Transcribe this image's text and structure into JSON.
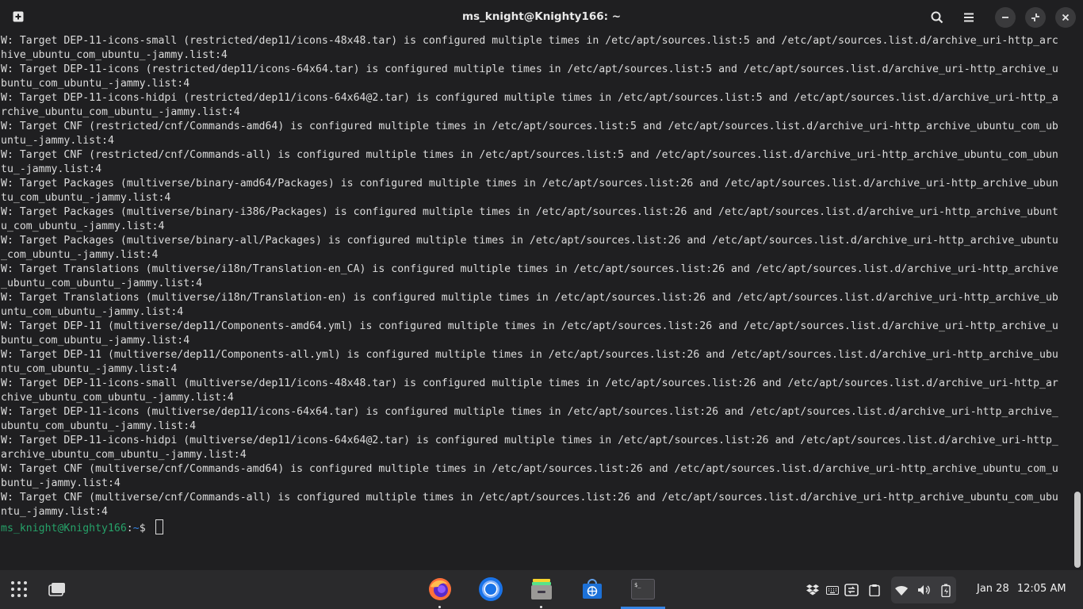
{
  "window": {
    "title": "ms_knight@Knighty166: ~"
  },
  "terminal": {
    "lines": [
      "W: Target DEP-11-icons-small (restricted/dep11/icons-48x48.tar) is configured multiple times in /etc/apt/sources.list:5 and /etc/apt/sources.list.d/archive_uri-http_arc",
      "hive_ubuntu_com_ubuntu_-jammy.list:4",
      "W: Target DEP-11-icons (restricted/dep11/icons-64x64.tar) is configured multiple times in /etc/apt/sources.list:5 and /etc/apt/sources.list.d/archive_uri-http_archive_u",
      "buntu_com_ubuntu_-jammy.list:4",
      "W: Target DEP-11-icons-hidpi (restricted/dep11/icons-64x64@2.tar) is configured multiple times in /etc/apt/sources.list:5 and /etc/apt/sources.list.d/archive_uri-http_a",
      "rchive_ubuntu_com_ubuntu_-jammy.list:4",
      "W: Target CNF (restricted/cnf/Commands-amd64) is configured multiple times in /etc/apt/sources.list:5 and /etc/apt/sources.list.d/archive_uri-http_archive_ubuntu_com_ub",
      "untu_-jammy.list:4",
      "W: Target CNF (restricted/cnf/Commands-all) is configured multiple times in /etc/apt/sources.list:5 and /etc/apt/sources.list.d/archive_uri-http_archive_ubuntu_com_ubun",
      "tu_-jammy.list:4",
      "W: Target Packages (multiverse/binary-amd64/Packages) is configured multiple times in /etc/apt/sources.list:26 and /etc/apt/sources.list.d/archive_uri-http_archive_ubun",
      "tu_com_ubuntu_-jammy.list:4",
      "W: Target Packages (multiverse/binary-i386/Packages) is configured multiple times in /etc/apt/sources.list:26 and /etc/apt/sources.list.d/archive_uri-http_archive_ubunt",
      "u_com_ubuntu_-jammy.list:4",
      "W: Target Packages (multiverse/binary-all/Packages) is configured multiple times in /etc/apt/sources.list:26 and /etc/apt/sources.list.d/archive_uri-http_archive_ubuntu",
      "_com_ubuntu_-jammy.list:4",
      "W: Target Translations (multiverse/i18n/Translation-en_CA) is configured multiple times in /etc/apt/sources.list:26 and /etc/apt/sources.list.d/archive_uri-http_archive",
      "_ubuntu_com_ubuntu_-jammy.list:4",
      "W: Target Translations (multiverse/i18n/Translation-en) is configured multiple times in /etc/apt/sources.list:26 and /etc/apt/sources.list.d/archive_uri-http_archive_ub",
      "untu_com_ubuntu_-jammy.list:4",
      "W: Target DEP-11 (multiverse/dep11/Components-amd64.yml) is configured multiple times in /etc/apt/sources.list:26 and /etc/apt/sources.list.d/archive_uri-http_archive_u",
      "buntu_com_ubuntu_-jammy.list:4",
      "W: Target DEP-11 (multiverse/dep11/Components-all.yml) is configured multiple times in /etc/apt/sources.list:26 and /etc/apt/sources.list.d/archive_uri-http_archive_ubu",
      "ntu_com_ubuntu_-jammy.list:4",
      "W: Target DEP-11-icons-small (multiverse/dep11/icons-48x48.tar) is configured multiple times in /etc/apt/sources.list:26 and /etc/apt/sources.list.d/archive_uri-http_ar",
      "chive_ubuntu_com_ubuntu_-jammy.list:4",
      "W: Target DEP-11-icons (multiverse/dep11/icons-64x64.tar) is configured multiple times in /etc/apt/sources.list:26 and /etc/apt/sources.list.d/archive_uri-http_archive_",
      "ubuntu_com_ubuntu_-jammy.list:4",
      "W: Target DEP-11-icons-hidpi (multiverse/dep11/icons-64x64@2.tar) is configured multiple times in /etc/apt/sources.list:26 and /etc/apt/sources.list.d/archive_uri-http_",
      "archive_ubuntu_com_ubuntu_-jammy.list:4",
      "W: Target CNF (multiverse/cnf/Commands-amd64) is configured multiple times in /etc/apt/sources.list:26 and /etc/apt/sources.list.d/archive_uri-http_archive_ubuntu_com_u",
      "buntu_-jammy.list:4",
      "W: Target CNF (multiverse/cnf/Commands-all) is configured multiple times in /etc/apt/sources.list:26 and /etc/apt/sources.list.d/archive_uri-http_archive_ubuntu_com_ubu",
      "ntu_-jammy.list:4"
    ],
    "prompt": {
      "user_host": "ms_knight@Knighty166",
      "colon": ":",
      "path": "~",
      "dollar": "$ "
    }
  },
  "taskbar": {
    "apps": [
      "firefox-icon",
      "chromium-icon",
      "files-icon",
      "software-store-icon",
      "terminal-icon"
    ],
    "tray": [
      "dropbox-icon",
      "keyboard-icon",
      "screen-share-icon",
      "clipboard-icon",
      "wifi-icon",
      "volume-icon",
      "battery-icon"
    ],
    "clock": {
      "date": "Jan 28",
      "time": "12:05 AM"
    }
  },
  "colors": {
    "background": "#1f1f21",
    "taskbar": "#2a2a2c",
    "prompt_user": "#26a269",
    "prompt_path": "#3584e4"
  }
}
